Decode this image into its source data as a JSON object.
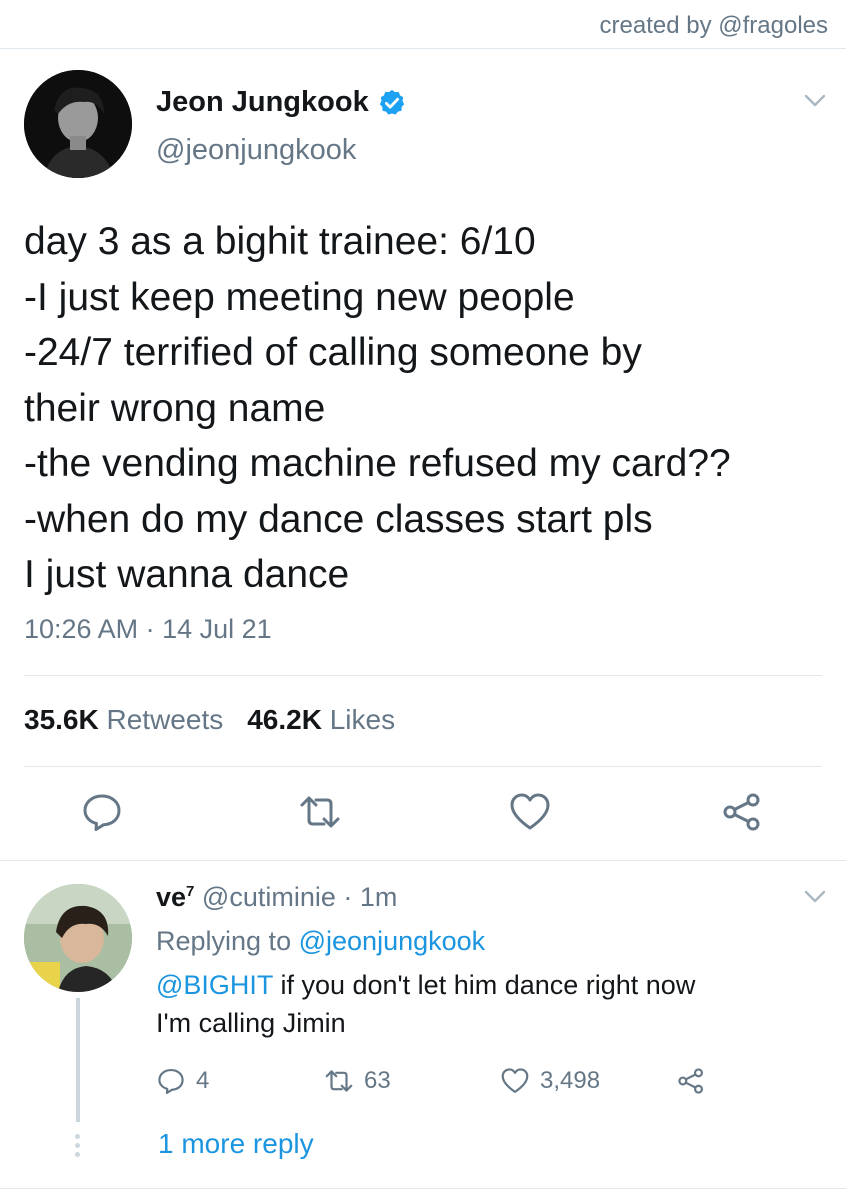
{
  "credit": "created by @fragoles",
  "tweet": {
    "author_name": "Jeon Jungkook",
    "author_handle": "@jeonjungkook",
    "lines": [
      "day 3 as a bighit trainee: 6/10",
      "-I just keep meeting new people",
      "-24/7 terrified of calling someone by",
      "their wrong name",
      "-the vending machine refused my card??",
      "-when do my dance classes start pls",
      "I just wanna dance"
    ],
    "time": "10:26 AM",
    "date": "14 Jul 21",
    "retweets_count": "35.6K",
    "retweets_label": "Retweets",
    "likes_count": "46.2K",
    "likes_label": "Likes"
  },
  "reply": {
    "name": "ve",
    "name_sup": "7",
    "handle": "@cutiminie",
    "time": "1m",
    "replying_prefix": "Replying to",
    "replying_to": "@jeonjungkook",
    "mention": "@BIGHIT",
    "text_rest": " if you don't let him dance right now",
    "text_line2": "I'm calling Jimin",
    "reply_count": "4",
    "retweet_count": "63",
    "like_count": "3,498"
  },
  "more_reply": "1 more reply",
  "colors": {
    "accent": "#1b95e0",
    "muted": "#657786",
    "text": "#14171a",
    "divider": "#e1e8ed"
  }
}
